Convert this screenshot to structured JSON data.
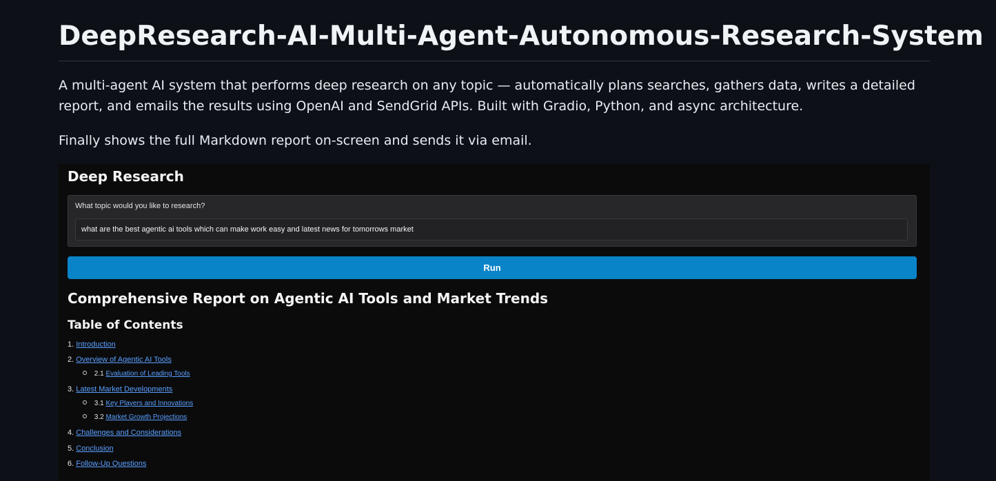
{
  "readme": {
    "title": "DeepResearch-AI-Multi-Agent-Autonomous-Research-System",
    "description": "A multi-agent AI system that performs deep research on any topic — automatically plans searches, gathers data, writes a detailed report, and emails the results using OpenAI and SendGrid APIs. Built with Gradio, Python, and async architecture.",
    "note": "Finally shows the full Markdown report on-screen and sends it via email."
  },
  "app": {
    "title": "Deep Research",
    "topic_label": "What topic would you like to research?",
    "topic_value": "what are the best agentic ai tools which can make work easy and latest news for tomorrows market",
    "run_label": "Run"
  },
  "report": {
    "heading": "Comprehensive Report on Agentic AI Tools and Market Trends",
    "toc_heading": "Table of Contents",
    "toc": [
      {
        "num": "1.",
        "label": "Introduction"
      },
      {
        "num": "2.",
        "label": "Overview of Agentic AI Tools"
      },
      {
        "num": "2.1",
        "label": "Evaluation of Leading Tools"
      },
      {
        "num": "3.",
        "label": "Latest Market Developments"
      },
      {
        "num": "3.1",
        "label": "Key Players and Innovations"
      },
      {
        "num": "3.2",
        "label": "Market Growth Projections"
      },
      {
        "num": "4.",
        "label": "Challenges and Considerations"
      },
      {
        "num": "5.",
        "label": "Conclusion"
      },
      {
        "num": "6.",
        "label": "Follow-Up Questions"
      }
    ]
  },
  "colors": {
    "page_bg": "#0d1017",
    "app_bg": "#0b0b0c",
    "accent": "#0a84c9",
    "link": "#5aa0ff"
  }
}
